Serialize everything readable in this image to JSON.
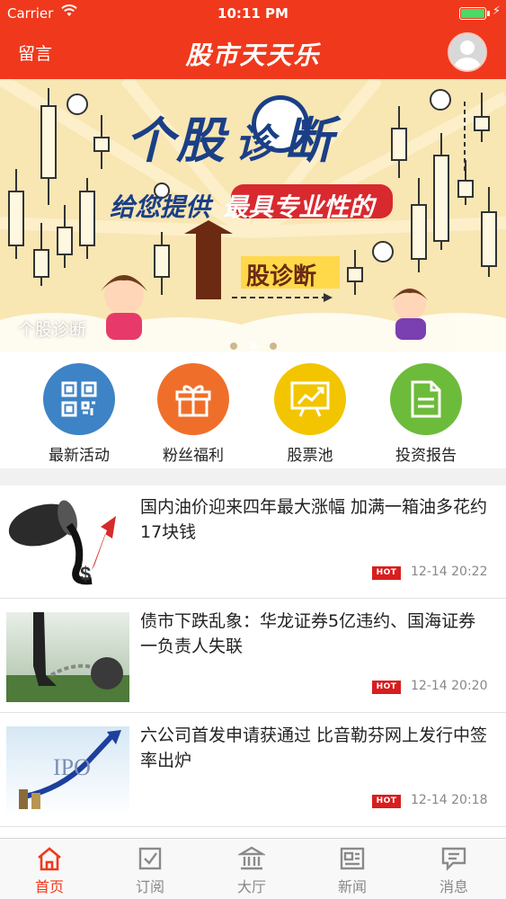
{
  "status_bar": {
    "carrier": "Carrier",
    "time": "10:11 PM"
  },
  "nav": {
    "left_button": "留言",
    "title": "股市天天乐",
    "avatar_icon": "user-avatar-icon"
  },
  "banner": {
    "headline_1": "个",
    "headline_2": "股",
    "headline_badge": "诊",
    "headline_3": "断",
    "subline_a": "给您提供",
    "subline_b": "最具专业性的",
    "arrow_text": "股诊断",
    "caption": "个股诊断",
    "dots": 3,
    "active_dot": 2
  },
  "quick_menu": [
    {
      "label": "最新活动",
      "icon": "qr-code-icon",
      "color": "#3d83c6"
    },
    {
      "label": "粉丝福利",
      "icon": "gift-icon",
      "color": "#ef6f2a"
    },
    {
      "label": "股票池",
      "icon": "chart-board-icon",
      "color": "#f2c500"
    },
    {
      "label": "投资报告",
      "icon": "document-icon",
      "color": "#6dbb3b"
    }
  ],
  "news": [
    {
      "title": "国内油价迎来四年最大涨幅 加满一箱油多花约17块钱",
      "badge": "HOT",
      "time": "12-14 20:22"
    },
    {
      "title": "债市下跌乱象：华龙证券5亿违约、国海证券一负责人失联",
      "badge": "HOT",
      "time": "12-14 20:20"
    },
    {
      "title": "六公司首发申请获通过 比音勒芬网上发行中签率出炉",
      "badge": "HOT",
      "time": "12-14 20:18"
    }
  ],
  "news_thumb_text": {
    "ipo": "IPO"
  },
  "tabs": [
    {
      "label": "首页",
      "icon": "home-icon",
      "active": true
    },
    {
      "label": "订阅",
      "icon": "checkbox-icon",
      "active": false
    },
    {
      "label": "大厅",
      "icon": "bank-icon",
      "active": false
    },
    {
      "label": "新闻",
      "icon": "newspaper-icon",
      "active": false
    },
    {
      "label": "消息",
      "icon": "message-icon",
      "active": false
    }
  ],
  "colors": {
    "brand": "#f0391c",
    "hot": "#d81e1e",
    "banner_bg": "#f8e6b3"
  }
}
